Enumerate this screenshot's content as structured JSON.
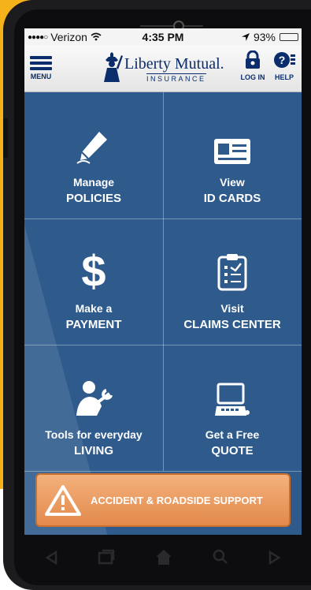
{
  "status": {
    "carrier": "Verizon",
    "time": "4:35 PM",
    "battery": "93%",
    "battery_level": 0.93
  },
  "header": {
    "menu_label": "MENU",
    "brand": "Liberty Mutual.",
    "brand_sub": "INSURANCE",
    "login_label": "LOG IN",
    "help_label": "HELP"
  },
  "tiles": [
    {
      "line1": "Manage",
      "line2": "POLICIES",
      "icon": "pen-icon"
    },
    {
      "line1": "View",
      "line2": "ID CARDS",
      "icon": "id-card-icon"
    },
    {
      "line1": "Make a",
      "line2": "PAYMENT",
      "icon": "dollar-icon"
    },
    {
      "line1": "Visit",
      "line2": "CLAIMS CENTER",
      "icon": "clipboard-icon"
    },
    {
      "line1": "Tools for everyday",
      "line2": "LIVING",
      "icon": "mechanic-icon"
    },
    {
      "line1": "Get a Free",
      "line2": "QUOTE",
      "icon": "computer-icon"
    }
  ],
  "accident": {
    "label": "ACCIDENT & ROADSIDE SUPPORT",
    "icon": "warning-icon"
  },
  "nav": {
    "icons": [
      "back-icon",
      "recent-apps-icon",
      "home-icon",
      "search-icon",
      "forward-icon"
    ]
  },
  "colors": {
    "screen_blue": "#2e5a8c",
    "brand_navy": "#0b2d6b",
    "accident_orange": "#e38a4c",
    "accent_yellow": "#f5b21a"
  }
}
